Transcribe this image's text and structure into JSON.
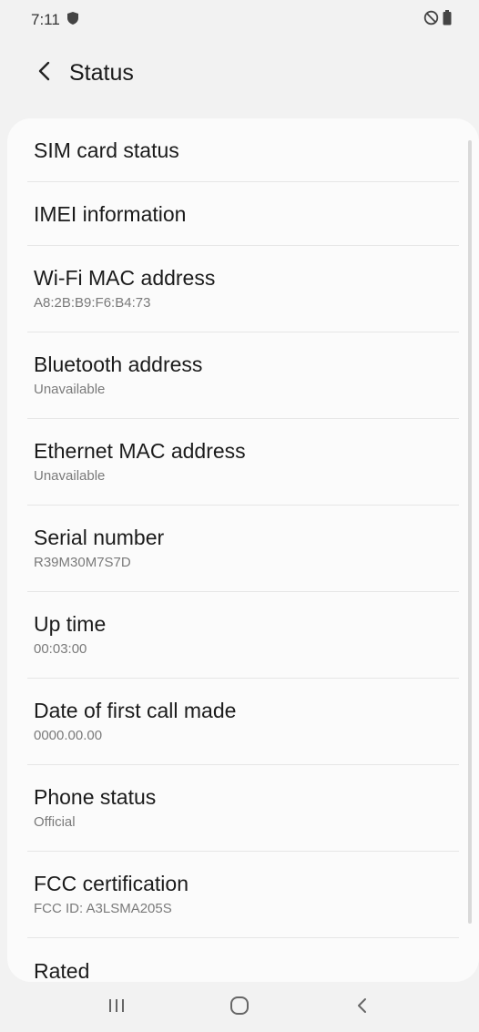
{
  "status_bar": {
    "time": "7:11",
    "left_icons": [
      "shield-icon"
    ],
    "right_icons": [
      "do-not-disturb-icon",
      "battery-icon"
    ]
  },
  "header": {
    "back_icon": "chevron-left-icon",
    "title": "Status"
  },
  "items": [
    {
      "title": "SIM card status",
      "subtitle": ""
    },
    {
      "title": "IMEI information",
      "subtitle": ""
    },
    {
      "title": "Wi-Fi MAC address",
      "subtitle": "A8:2B:B9:F6:B4:73"
    },
    {
      "title": "Bluetooth address",
      "subtitle": "Unavailable"
    },
    {
      "title": "Ethernet MAC address",
      "subtitle": "Unavailable"
    },
    {
      "title": "Serial number",
      "subtitle": "R39M30M7S7D"
    },
    {
      "title": "Up time",
      "subtitle": "00:03:00"
    },
    {
      "title": "Date of first call made",
      "subtitle": "0000.00.00"
    },
    {
      "title": "Phone status",
      "subtitle": "Official"
    },
    {
      "title": "FCC certification",
      "subtitle": "FCC ID: A3LSMA205S"
    },
    {
      "title": "Rated",
      "subtitle": ""
    }
  ],
  "nav_bar": {
    "icons": [
      "recent-apps-icon",
      "home-icon",
      "back-icon"
    ]
  },
  "colors": {
    "background": "#f2f2f2",
    "card": "#fbfbfb",
    "title_text": "#1b1b1b",
    "subtitle_text": "#7a7a7a",
    "divider": "#e6e6e6"
  }
}
